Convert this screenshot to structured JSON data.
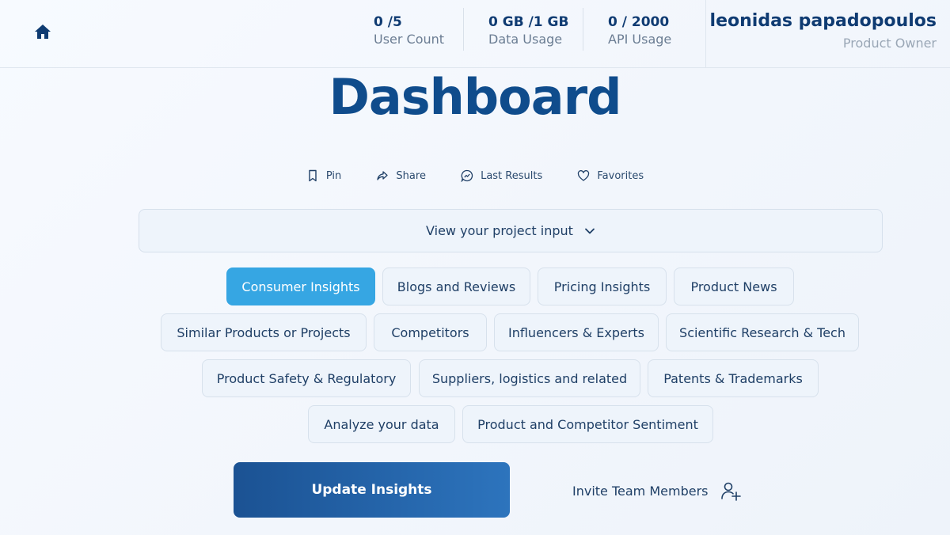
{
  "header": {
    "stats": [
      {
        "value": "0 /5",
        "label": "User Count"
      },
      {
        "value": "0 GB /1 GB",
        "label": "Data Usage"
      },
      {
        "value": "0 / 2000",
        "label": "API Usage"
      }
    ],
    "user": {
      "name": "leonidas papadopoulos",
      "role": "Product Owner"
    }
  },
  "page": {
    "title": "Dashboard"
  },
  "actions": {
    "pin": "Pin",
    "share": "Share",
    "last_results": "Last Results",
    "favorites": "Favorites"
  },
  "project_input": {
    "label": "View your project input"
  },
  "categories": [
    "Consumer Insights",
    "Blogs and Reviews",
    "Pricing Insights",
    "Product News",
    "Similar Products or Projects",
    "Competitors",
    "Influencers & Experts",
    "Scientific Research & Tech",
    "Product Safety & Regulatory",
    "Suppliers, logistics and related",
    "Patents & Trademarks",
    "Analyze your data",
    "Product and Competitor Sentiment"
  ],
  "active_category": "Consumer Insights",
  "buttons": {
    "update": "Update Insights",
    "invite": "Invite Team Members"
  },
  "colors": {
    "primary": "#0f4c8c",
    "accent": "#36a6e3"
  }
}
